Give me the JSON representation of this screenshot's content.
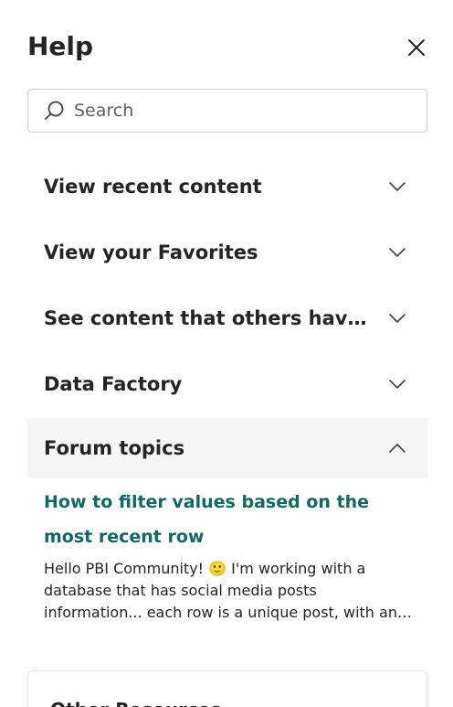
{
  "header": {
    "title": "Help"
  },
  "search": {
    "placeholder": "Search"
  },
  "sections": [
    {
      "label": "View recent content",
      "expanded": false
    },
    {
      "label": "View your Favorites",
      "expanded": false
    },
    {
      "label": "See content that others have sh...",
      "expanded": false
    },
    {
      "label": "Data Factory",
      "expanded": false
    },
    {
      "label": "Forum topics",
      "expanded": true
    }
  ],
  "forum": {
    "link_text": "How to filter values based on the most recent row",
    "snippet": "Hello PBI Community! 🙂 I'm working with a database that has social media posts information... each row is a unique post, with an unique id,..."
  },
  "resources": {
    "title": "Other Resources"
  },
  "colors": {
    "link": "#0f6b61",
    "expanded_bg": "#f5f5f5",
    "text": "#242424",
    "border": "#cfcfcf"
  }
}
